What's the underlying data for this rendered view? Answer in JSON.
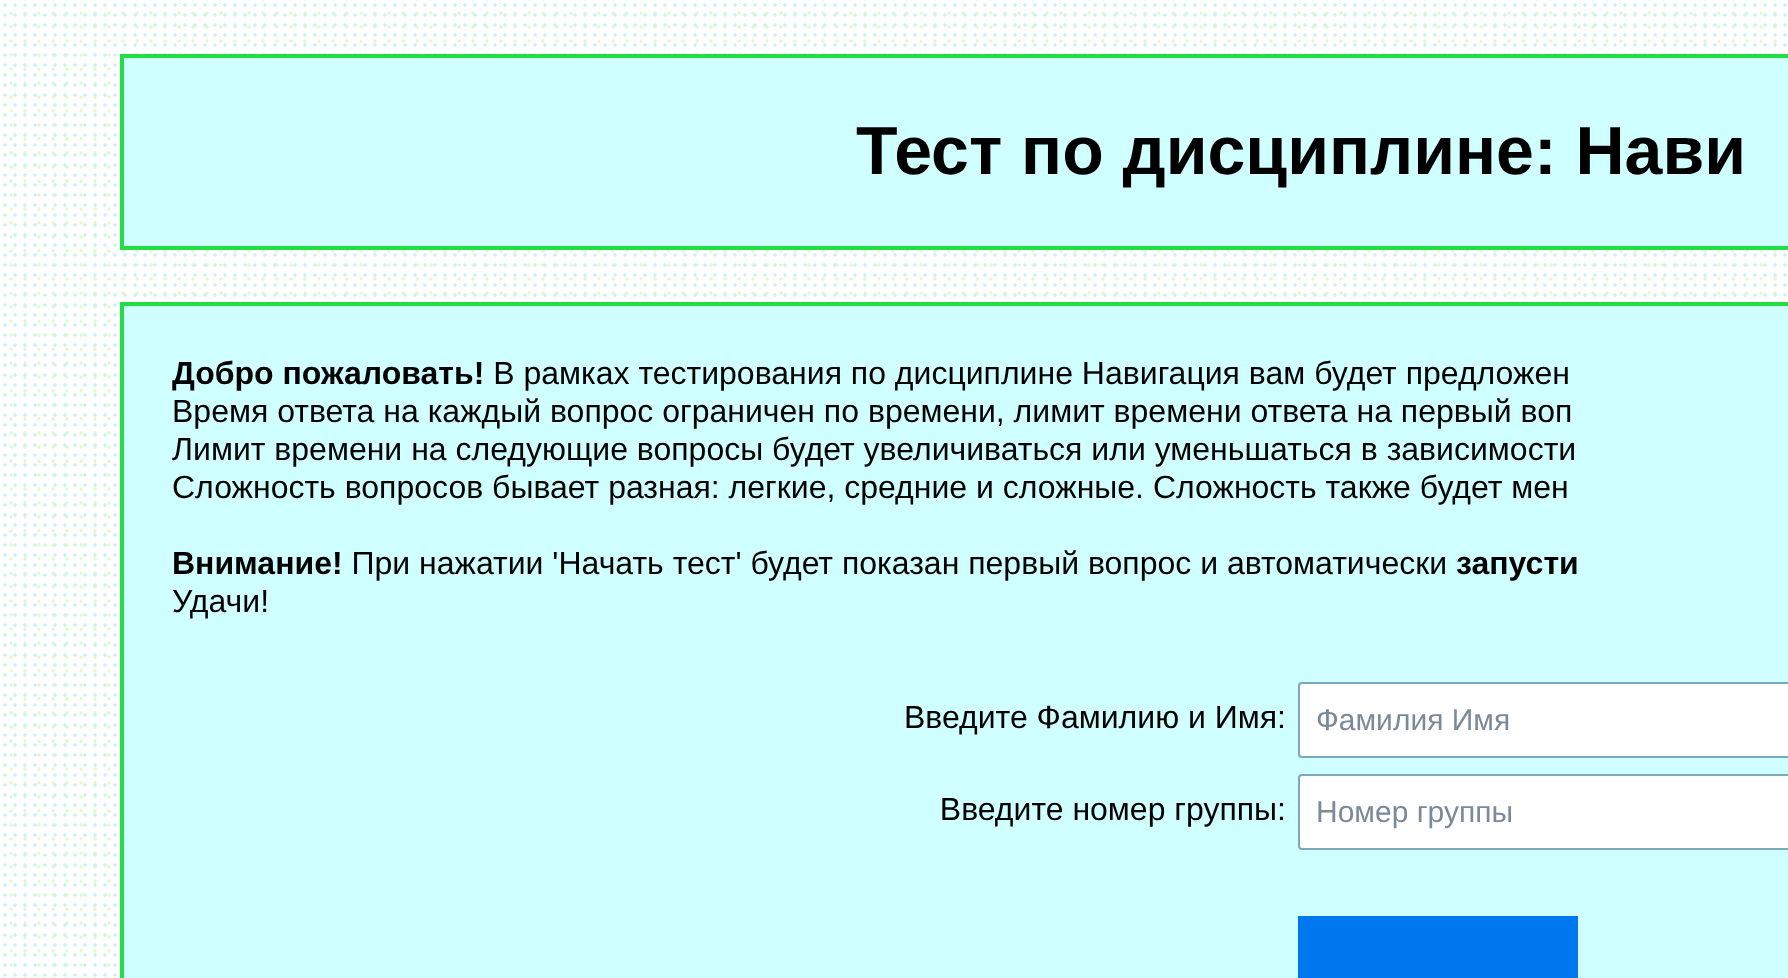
{
  "header": {
    "title": "Тест по дисциплине: Нави"
  },
  "intro": [
    "**Добро пожаловать!** В рамках тестирования по дисциплине Навигация вам будет предложен",
    "Время ответа на каждый вопрос ограничен по времени, лимит времени ответа на первый воп",
    "Лимит времени на следующие вопросы будет увеличиваться или уменьшаться в зависимости",
    "Сложность вопросов бывает разная: легкие, средние и сложные. Сложность также будет мен"
  ],
  "notice": [
    "**Внимание!** При нажатии 'Начать тест' будет показан первый вопрос и автоматически **запусти**",
    "Удачи!"
  ],
  "form": {
    "fields": [
      {
        "label": "Введите Фамилию и Имя:",
        "placeholder": "Фамилия Имя"
      },
      {
        "label": "Введите номер группы:",
        "placeholder": "Номер группы"
      }
    ],
    "submit": {
      "kind": "button"
    }
  }
}
